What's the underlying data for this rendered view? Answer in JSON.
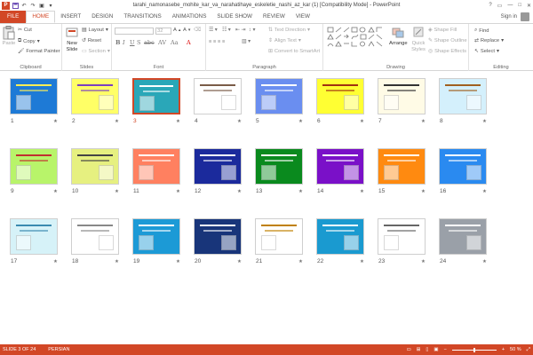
{
  "window": {
    "title": "tarahi_namonasebe_mohite_kar_va_narahatihaye_eskeletie_nashi_az_kar (1) [Compatibility Mode] - PowerPoint",
    "logo_text": "P",
    "controls": [
      "?",
      "▭",
      "—",
      "□",
      "✕"
    ]
  },
  "tabs": [
    "FILE",
    "HOME",
    "INSERT",
    "DESIGN",
    "TRANSITIONS",
    "ANIMATIONS",
    "SLIDE SHOW",
    "REVIEW",
    "VIEW"
  ],
  "active_tab": "HOME",
  "signin": "Sign in",
  "ribbon": {
    "clipboard": {
      "label": "Clipboard",
      "paste": "Paste",
      "cut": "Cut",
      "copy": "Copy",
      "format_painter": "Format Painter"
    },
    "slides": {
      "label": "Slides",
      "new_slide": "New Slide",
      "layout": "Layout",
      "reset": "Reset",
      "section": "Section"
    },
    "font": {
      "label": "Font",
      "size": "32",
      "bold": "B",
      "italic": "I",
      "underline": "U",
      "strike": "S",
      "shadow": "abc",
      "spacing": "AV",
      "case": "Aa",
      "color": "A"
    },
    "paragraph": {
      "label": "Paragraph",
      "text_direction": "Text Direction",
      "align_text": "Align Text",
      "convert_smartart": "Convert to SmartArt"
    },
    "drawing": {
      "label": "Drawing",
      "arrange": "Arrange",
      "quick_styles": "Quick Styles",
      "shape_fill": "Shape Fill",
      "shape_outline": "Shape Outline",
      "shape_effects": "Shape Effects"
    },
    "editing": {
      "label": "Editing",
      "find": "Find",
      "replace": "Replace",
      "select": "Select"
    }
  },
  "slides": [
    {
      "num": "1",
      "bg": "#1e7ad6",
      "fg": "#ffee55"
    },
    {
      "num": "2",
      "bg": "#ffff66",
      "fg": "#7a40c0"
    },
    {
      "num": "3",
      "bg": "#2aa7b8",
      "fg": "#ffffff"
    },
    {
      "num": "4",
      "bg": "#ffffff",
      "fg": "#7a5c48"
    },
    {
      "num": "5",
      "bg": "#6a8ef0",
      "fg": "#ffffff"
    },
    {
      "num": "6",
      "bg": "#ffff33",
      "fg": "#a03010"
    },
    {
      "num": "7",
      "bg": "#fffbe6",
      "fg": "#333333"
    },
    {
      "num": "8",
      "bg": "#d4f0fc",
      "fg": "#a06020"
    },
    {
      "num": "9",
      "bg": "#b8f46a",
      "fg": "#c03030"
    },
    {
      "num": "10",
      "bg": "#e6f080",
      "fg": "#444444"
    },
    {
      "num": "11",
      "bg": "#ff8060",
      "fg": "#ffffff"
    },
    {
      "num": "12",
      "bg": "#1b2a9c",
      "fg": "#ffffff"
    },
    {
      "num": "13",
      "bg": "#0a8a1e",
      "fg": "#ffffff"
    },
    {
      "num": "14",
      "bg": "#7a10c8",
      "fg": "#ffffff"
    },
    {
      "num": "15",
      "bg": "#ff8a10",
      "fg": "#ffffff"
    },
    {
      "num": "16",
      "bg": "#2a8af0",
      "fg": "#ffffff"
    },
    {
      "num": "17",
      "bg": "#d6f2f8",
      "fg": "#3a8ab0"
    },
    {
      "num": "18",
      "bg": "#ffffff",
      "fg": "#888888"
    },
    {
      "num": "19",
      "bg": "#1c9ad6",
      "fg": "#ffffff"
    },
    {
      "num": "20",
      "bg": "#18357a",
      "fg": "#ffffff"
    },
    {
      "num": "21",
      "bg": "#ffffff",
      "fg": "#c08000"
    },
    {
      "num": "22",
      "bg": "#1a9ad0",
      "fg": "#ffffff"
    },
    {
      "num": "23",
      "bg": "#ffffff",
      "fg": "#666666"
    },
    {
      "num": "24",
      "bg": "#9aa0a8",
      "fg": "#ffffff"
    }
  ],
  "selected_slide": "3",
  "status": {
    "slide_info": "SLIDE 3 OF 24",
    "language": "PERSIAN",
    "zoom": "50 %",
    "zoom_fraction": 0.5
  }
}
